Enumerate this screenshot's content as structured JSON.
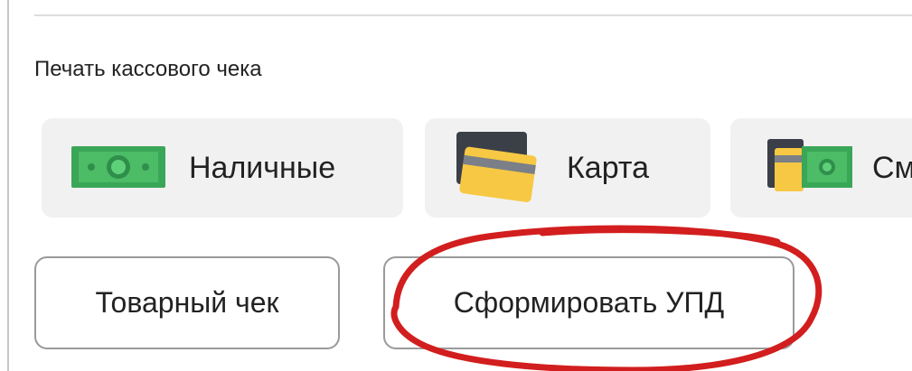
{
  "section": {
    "title": "Печать кассового чека"
  },
  "payment_buttons": [
    {
      "label": "Наличные",
      "icon": "cash-icon"
    },
    {
      "label": "Карта",
      "icon": "card-icon"
    },
    {
      "label": "Смешанная",
      "icon": "mixed-payment-icon"
    }
  ],
  "actions": {
    "receipt_label": "Товарный чек",
    "upd_label": "Сформировать УПД"
  },
  "colors": {
    "button_bg": "#f1f1f1",
    "cash_green": "#3aa657",
    "card_yellow": "#f7c843",
    "card_dark": "#3b3f48",
    "annotation_red": "#d21e1e",
    "outline_border": "#9a9a9a"
  }
}
